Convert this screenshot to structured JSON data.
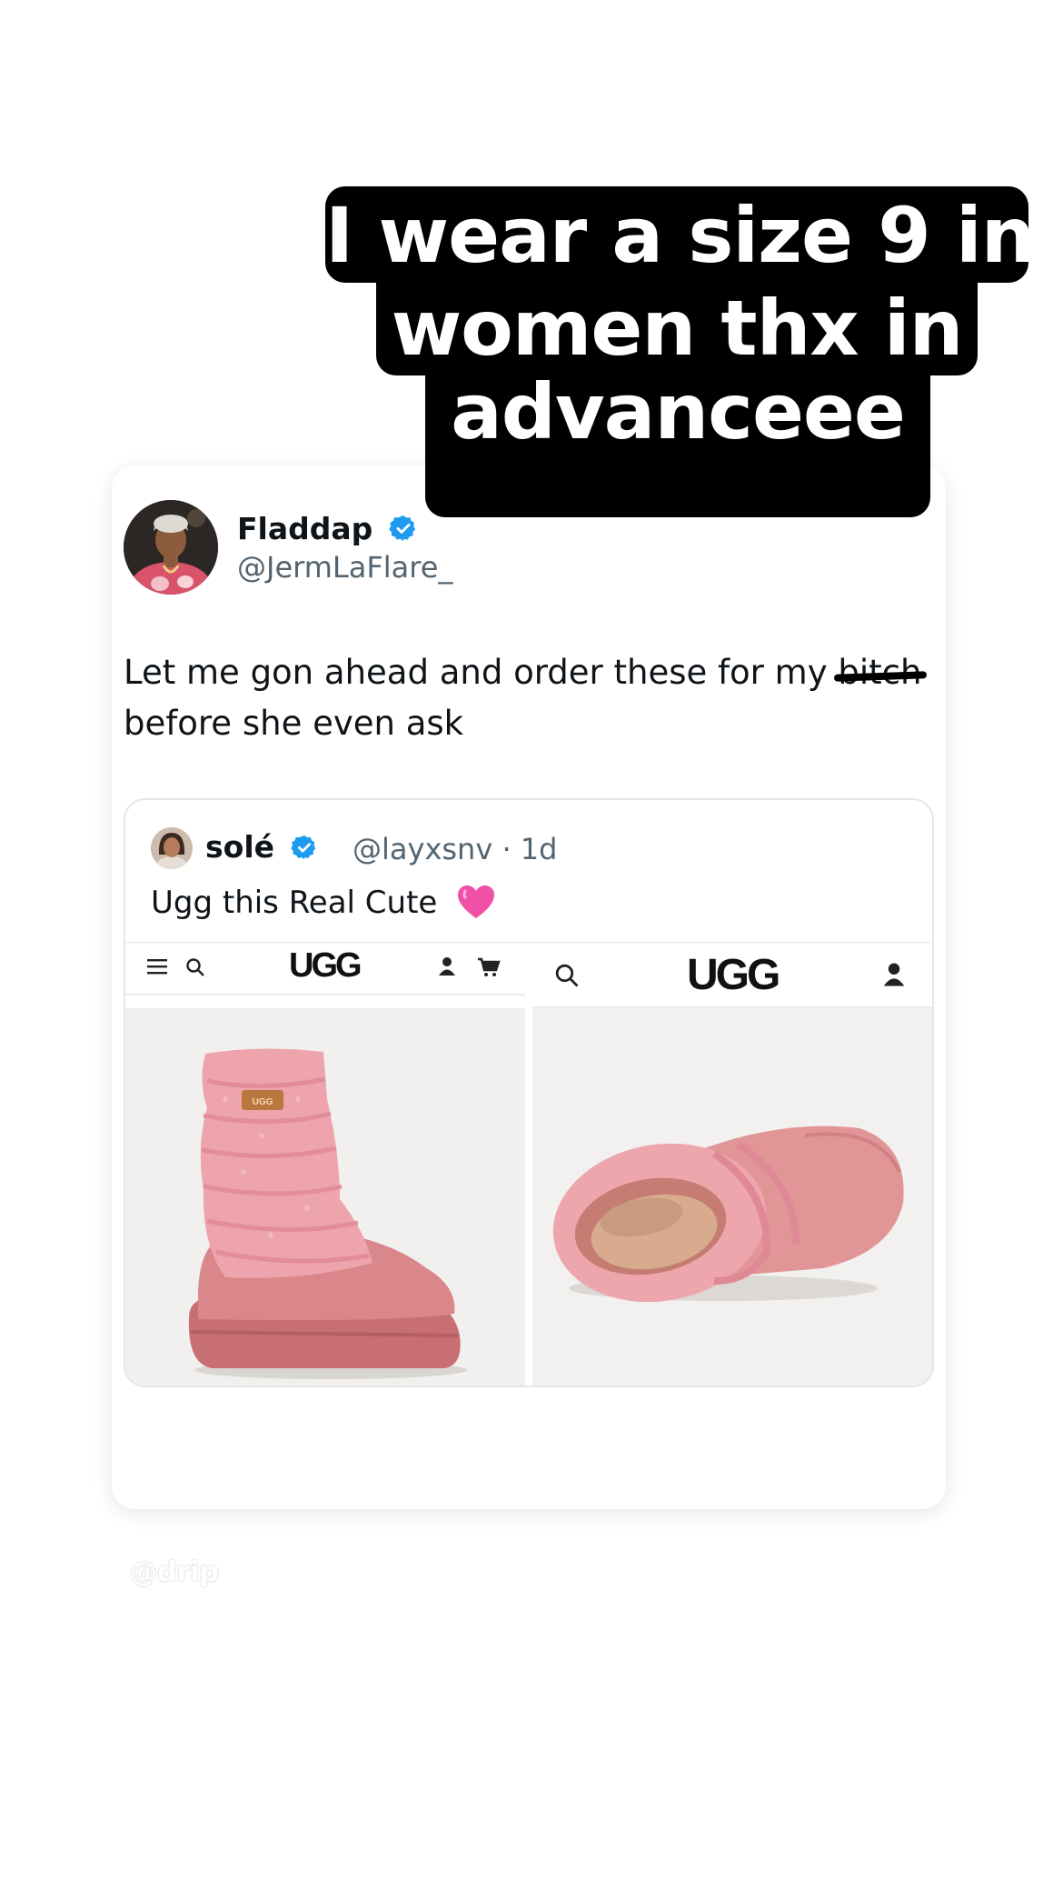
{
  "caption": {
    "line1": "I wear a size 9 in",
    "line2": "women thx in",
    "line3": "advanceee"
  },
  "tweet": {
    "display_name": "Fladdap",
    "handle": "@JermLaFlare_",
    "text_before": "Let me gon ahead and order these for my ",
    "redacted_word": "bitch",
    "text_after": "before she even ask",
    "verified_icon": "verified-badge-icon",
    "accent_color": "#1d9bf0"
  },
  "quote": {
    "display_name": "solé",
    "handle_time": "@layxsnv · 1d",
    "text": "Ugg this Real Cute",
    "emoji": "pink-heart-icon",
    "media": {
      "left_logo": "UGG",
      "right_logo": "UGG",
      "left_image": "pink knit slouch platform boot",
      "right_image": "pink knit slipper top view"
    }
  },
  "watermark": "@drip"
}
